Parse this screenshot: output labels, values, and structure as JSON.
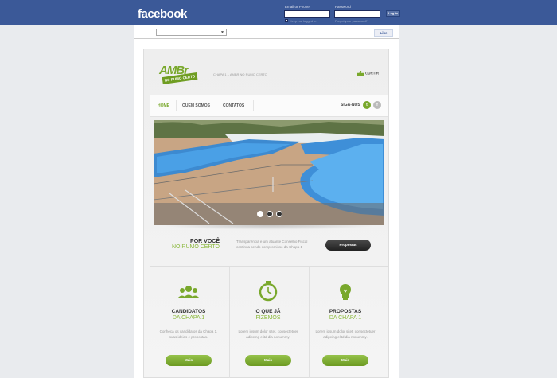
{
  "fb": {
    "logo": "facebook",
    "email_label": "Email or Phone",
    "password_label": "Password",
    "login_button": "Log In",
    "keep_logged": "Keep me logged in",
    "forgot": "Forgot your password?"
  },
  "strip": {
    "like_button": "Like"
  },
  "site": {
    "logo_text": "AMBr",
    "logo_ribbon": "NO RUMO CERTO",
    "tagline": "CHAPA 1 – AMBR NO RUMO CERTO",
    "curtir": "CURTIR"
  },
  "nav": {
    "items": [
      "HOME",
      "QUEM SOMOS",
      "CONTATOS"
    ],
    "siga": "SIGA-NOS"
  },
  "intro": {
    "title": "POR VOCÊ",
    "subtitle": "NO RUMO CERTO",
    "text": "Transparência e um atuante Conselho Fiscal continua sendo compromisso da Chapa 1",
    "button": "Propostas"
  },
  "columns": [
    {
      "title": "CANDIDATOS",
      "subtitle": "DA CHAPA 1",
      "text": "Conheça os candidatos da Chapa 1, suas ideias e propostas.",
      "button": "Mais",
      "icon": "people-icon"
    },
    {
      "title": "O QUE JÁ",
      "subtitle": "FIZEMOS",
      "text": "Lorem ipsum dolor sitet, consectetuer adipcing elitd dia nonummy.",
      "button": "Mais",
      "icon": "stopwatch-icon"
    },
    {
      "title": "PROPOSTAS",
      "subtitle": "DA CHAPA 1",
      "text": "Lorem ipsum dolor sitet, consectetuer adipcing elitd dia nonummy.",
      "button": "Mais",
      "icon": "lightbulb-icon"
    }
  ],
  "colors": {
    "fb_blue": "#3b5998",
    "accent_green": "#79a82c"
  }
}
